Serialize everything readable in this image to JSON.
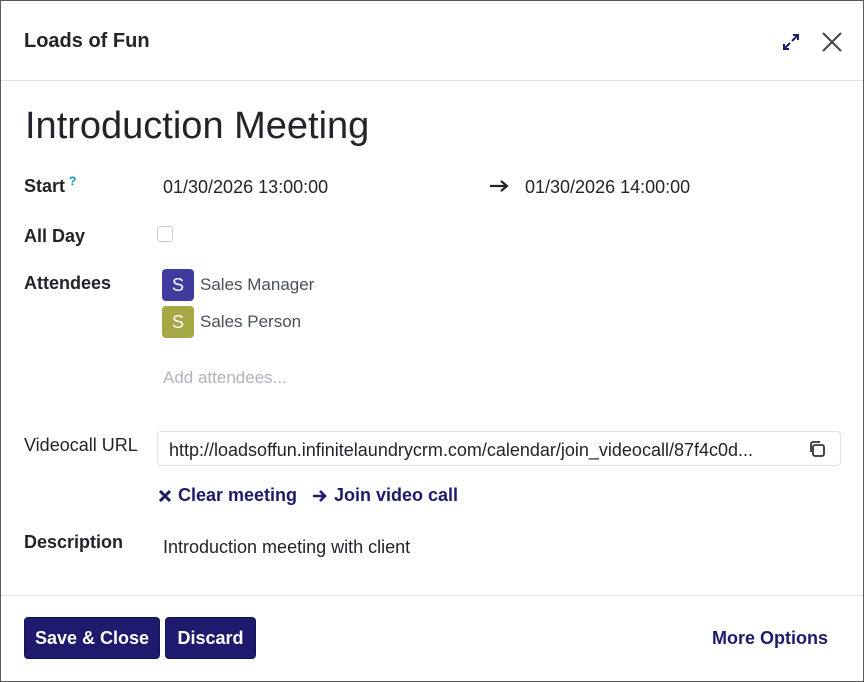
{
  "dialog": {
    "title": "Loads of Fun",
    "expand_icon": "expand-arrows-icon",
    "close_icon": "close-icon"
  },
  "record": {
    "name": "Introduction Meeting"
  },
  "fields": {
    "start": {
      "label": "Start",
      "help": "?",
      "start_value": "01/30/2026 13:00:00",
      "end_value": "01/30/2026 14:00:00",
      "arrow_icon": "long-arrow-right-icon"
    },
    "all_day": {
      "label": "All Day",
      "checked": false
    },
    "attendees": {
      "label": "Attendees",
      "items": [
        {
          "initial": "S",
          "name": "Sales Manager",
          "color": "#3f3c9e"
        },
        {
          "initial": "S",
          "name": "Sales Person",
          "color": "#a5a845"
        }
      ],
      "placeholder": "Add attendees..."
    },
    "videocall": {
      "label": "Videocall URL",
      "value": "http://loadsoffun.infinitelaundrycrm.com/calendar/join_videocall/87f4c0d...",
      "copy_icon": "copy-icon",
      "clear_label": "Clear meeting",
      "join_label": "Join video call"
    },
    "description": {
      "label": "Description",
      "value": "Introduction meeting with client"
    }
  },
  "footer": {
    "save_label": "Save & Close",
    "discard_label": "Discard",
    "more_label": "More Options"
  },
  "colors": {
    "primary": "#1e1a6e",
    "help": "#0891b2",
    "placeholder": "#adb5bd"
  }
}
